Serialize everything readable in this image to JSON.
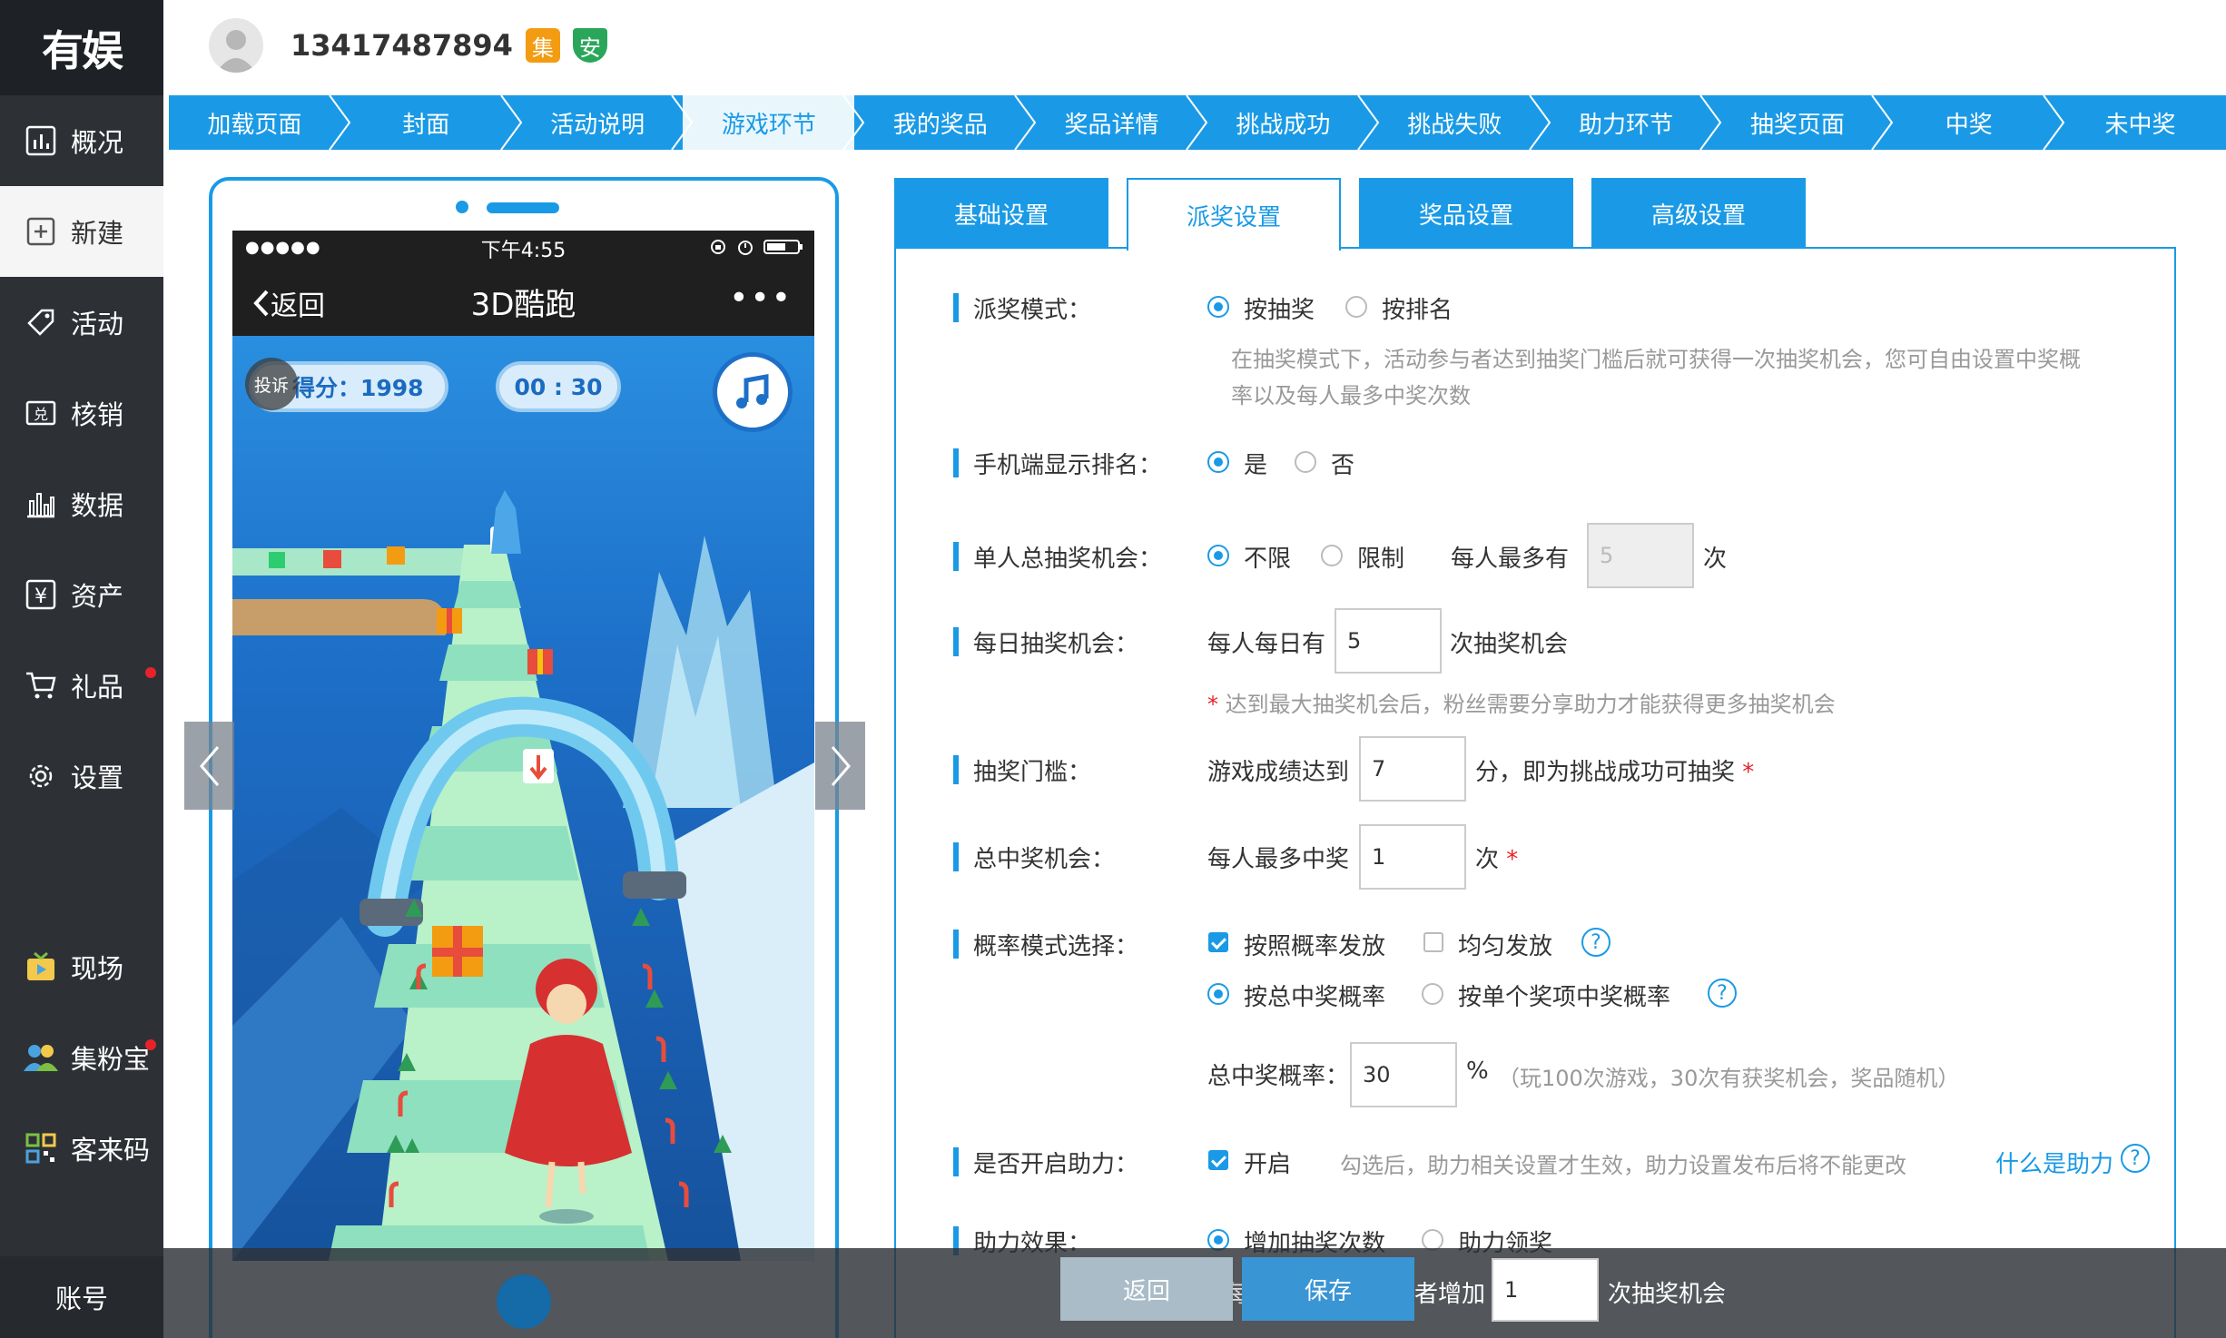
{
  "brand": {
    "logo_text": "有娱"
  },
  "sidebar": {
    "items": [
      {
        "label": "概况",
        "icon": "chart-icon"
      },
      {
        "label": "新建",
        "icon": "plus-square-icon"
      },
      {
        "label": "活动",
        "icon": "tag-icon"
      },
      {
        "label": "核销",
        "icon": "redeem-icon"
      },
      {
        "label": "数据",
        "icon": "bar-chart-icon"
      },
      {
        "label": "资产",
        "icon": "yen-icon"
      },
      {
        "label": "礼品",
        "icon": "cart-icon"
      },
      {
        "label": "设置",
        "icon": "gear-icon"
      },
      {
        "label": "现场",
        "icon": "tv-icon"
      },
      {
        "label": "集粉宝",
        "icon": "users-icon"
      },
      {
        "label": "客来码",
        "icon": "qrcode-icon"
      }
    ],
    "account_label": "账号"
  },
  "header": {
    "phone": "13417487894",
    "badge_collect": "集",
    "badge_safe": "安"
  },
  "steps": [
    "加载页面",
    "封面",
    "活动说明",
    "游戏环节",
    "我的奖品",
    "奖品详情",
    "挑战成功",
    "挑战失败",
    "助力环节",
    "抽奖页面",
    "中奖",
    "未中奖"
  ],
  "preview": {
    "carrier_dots": "●●●●●",
    "time": "下午4:55",
    "back_label": "返回",
    "title": "3D酷跑",
    "more": "•••",
    "complain": "投诉",
    "score": "得分：1998",
    "timer": "00 : 30"
  },
  "tabs": [
    "基础设置",
    "派奖设置",
    "奖品设置",
    "高级设置"
  ],
  "form": {
    "award_mode": {
      "label": "派奖模式：",
      "opt1": "按抽奖",
      "opt2": "按排名",
      "hint1": "在抽奖模式下，活动参与者达到抽奖门槛后就可获得一次抽奖机会，您可自由设置中奖概",
      "hint2": "率以及每人最多中奖次数"
    },
    "show_rank": {
      "label": "手机端显示排名：",
      "opt1": "是",
      "opt2": "否"
    },
    "total_chances": {
      "label": "单人总抽奖机会：",
      "opt1": "不限",
      "opt2": "限制",
      "prefix": "每人最多有",
      "value": "5",
      "suffix": "次"
    },
    "daily_chances": {
      "label": "每日抽奖机会：",
      "prefix": "每人每日有",
      "value": "5",
      "suffix": "次抽奖机会",
      "hint": "达到最大抽奖机会后，粉丝需要分享助力才能获得更多抽奖机会",
      "star": "*"
    },
    "threshold": {
      "label": "抽奖门槛：",
      "prefix": "游戏成绩达到",
      "value": "7",
      "suffix": "分，即为挑战成功可抽奖",
      "star": "*"
    },
    "total_wins": {
      "label": "总中奖机会：",
      "prefix": "每人最多中奖",
      "value": "1",
      "suffix": "次",
      "star": "*"
    },
    "prob_mode": {
      "label": "概率模式选择：",
      "opt1": "按照概率发放",
      "opt2": "均匀发放",
      "opt3": "按总中奖概率",
      "opt4": "按单个奖项中奖概率",
      "q": "?"
    },
    "total_prob": {
      "prefix": "总中奖概率：",
      "value": "30",
      "unit": "%",
      "hint": "（玩100次游戏，30次有获奖机会，奖品随机）"
    },
    "assist": {
      "label": "是否开启助力：",
      "opt": "开启",
      "hint": "勾选后，助力相关设置才生效，助力设置发布后将不能更改",
      "link": "什么是助力",
      "q": "?"
    },
    "assist_effect": {
      "label": "助力效果：",
      "opt1": "增加抽奖次数",
      "opt2": "助力领奖"
    },
    "assist_increase": {
      "prefix_hidden": "每",
      "mid": "者增加",
      "value": "1",
      "suffix": "次抽奖机会"
    }
  },
  "buttons": {
    "back": "返回",
    "save": "保存"
  },
  "colors": {
    "primary": "#1a9ae6",
    "sidebar": "#2d3136",
    "alert": "#e8222a",
    "badge_orange": "#f39c12",
    "badge_green": "#2aa65a"
  }
}
